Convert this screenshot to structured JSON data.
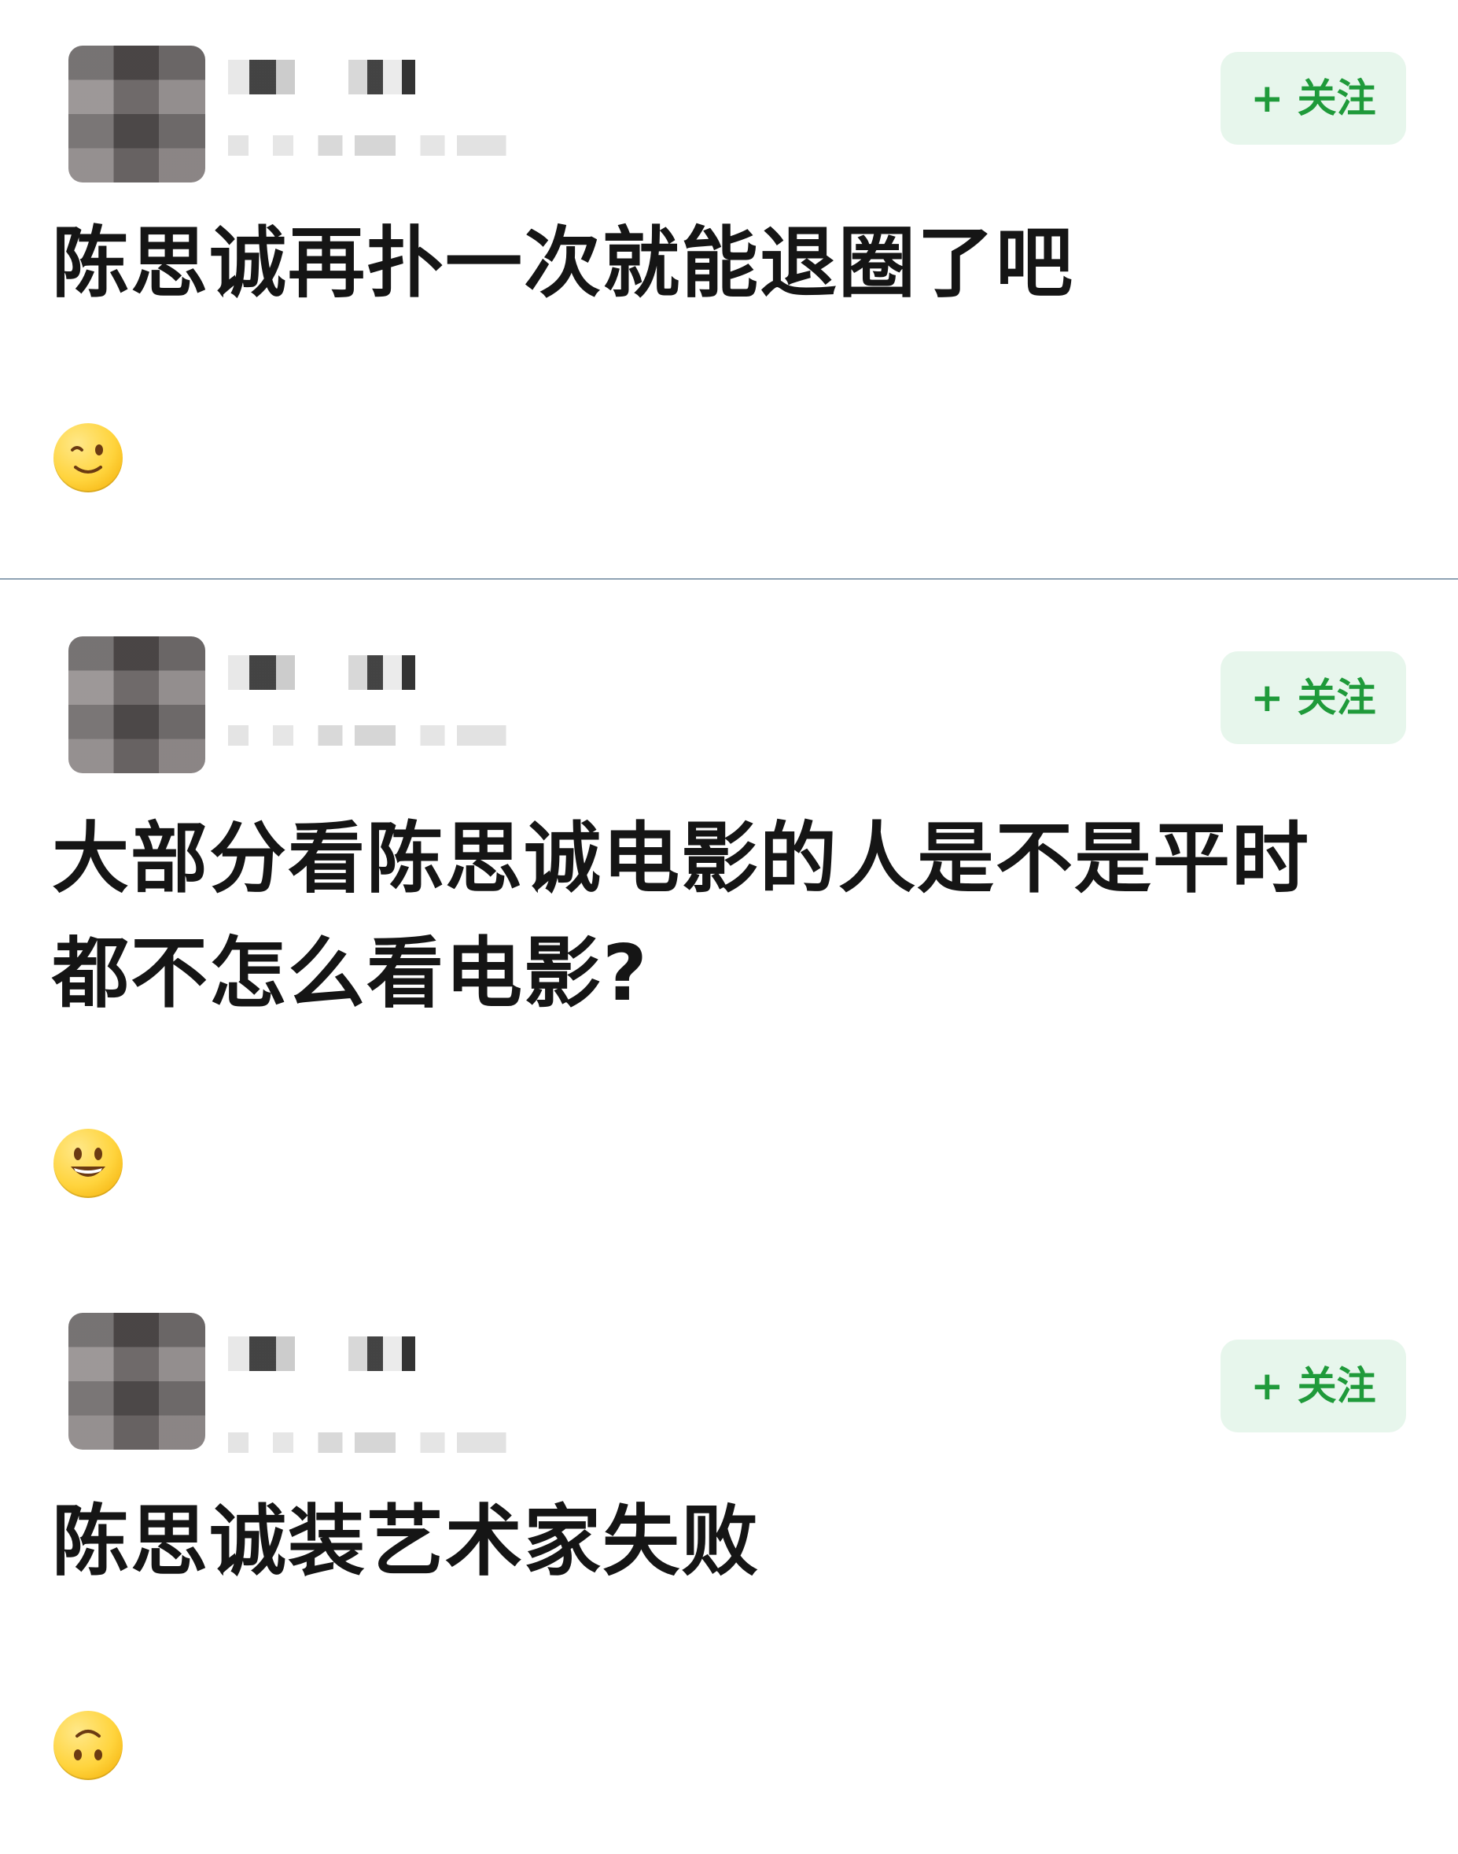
{
  "colors": {
    "background": "#ffffff",
    "follow_button_bg": "#e7f6ec",
    "follow_button_text": "#1f9a3a",
    "divider": "#8ea2b3",
    "text": "#151515"
  },
  "posts": [
    {
      "follow_label": "+ 关注",
      "text": "陈思诚再扑一次就能退圈了吧",
      "emoji": "winking-face-emoji"
    },
    {
      "follow_label": "+ 关注",
      "text": "大部分看陈思诚电影的人是不是平时都不怎么看电影?",
      "emoji": "grinning-face-emoji"
    },
    {
      "follow_label": "+ 关注",
      "text": "陈思诚装艺术家失败",
      "emoji": "upside-down-face-emoji"
    }
  ]
}
